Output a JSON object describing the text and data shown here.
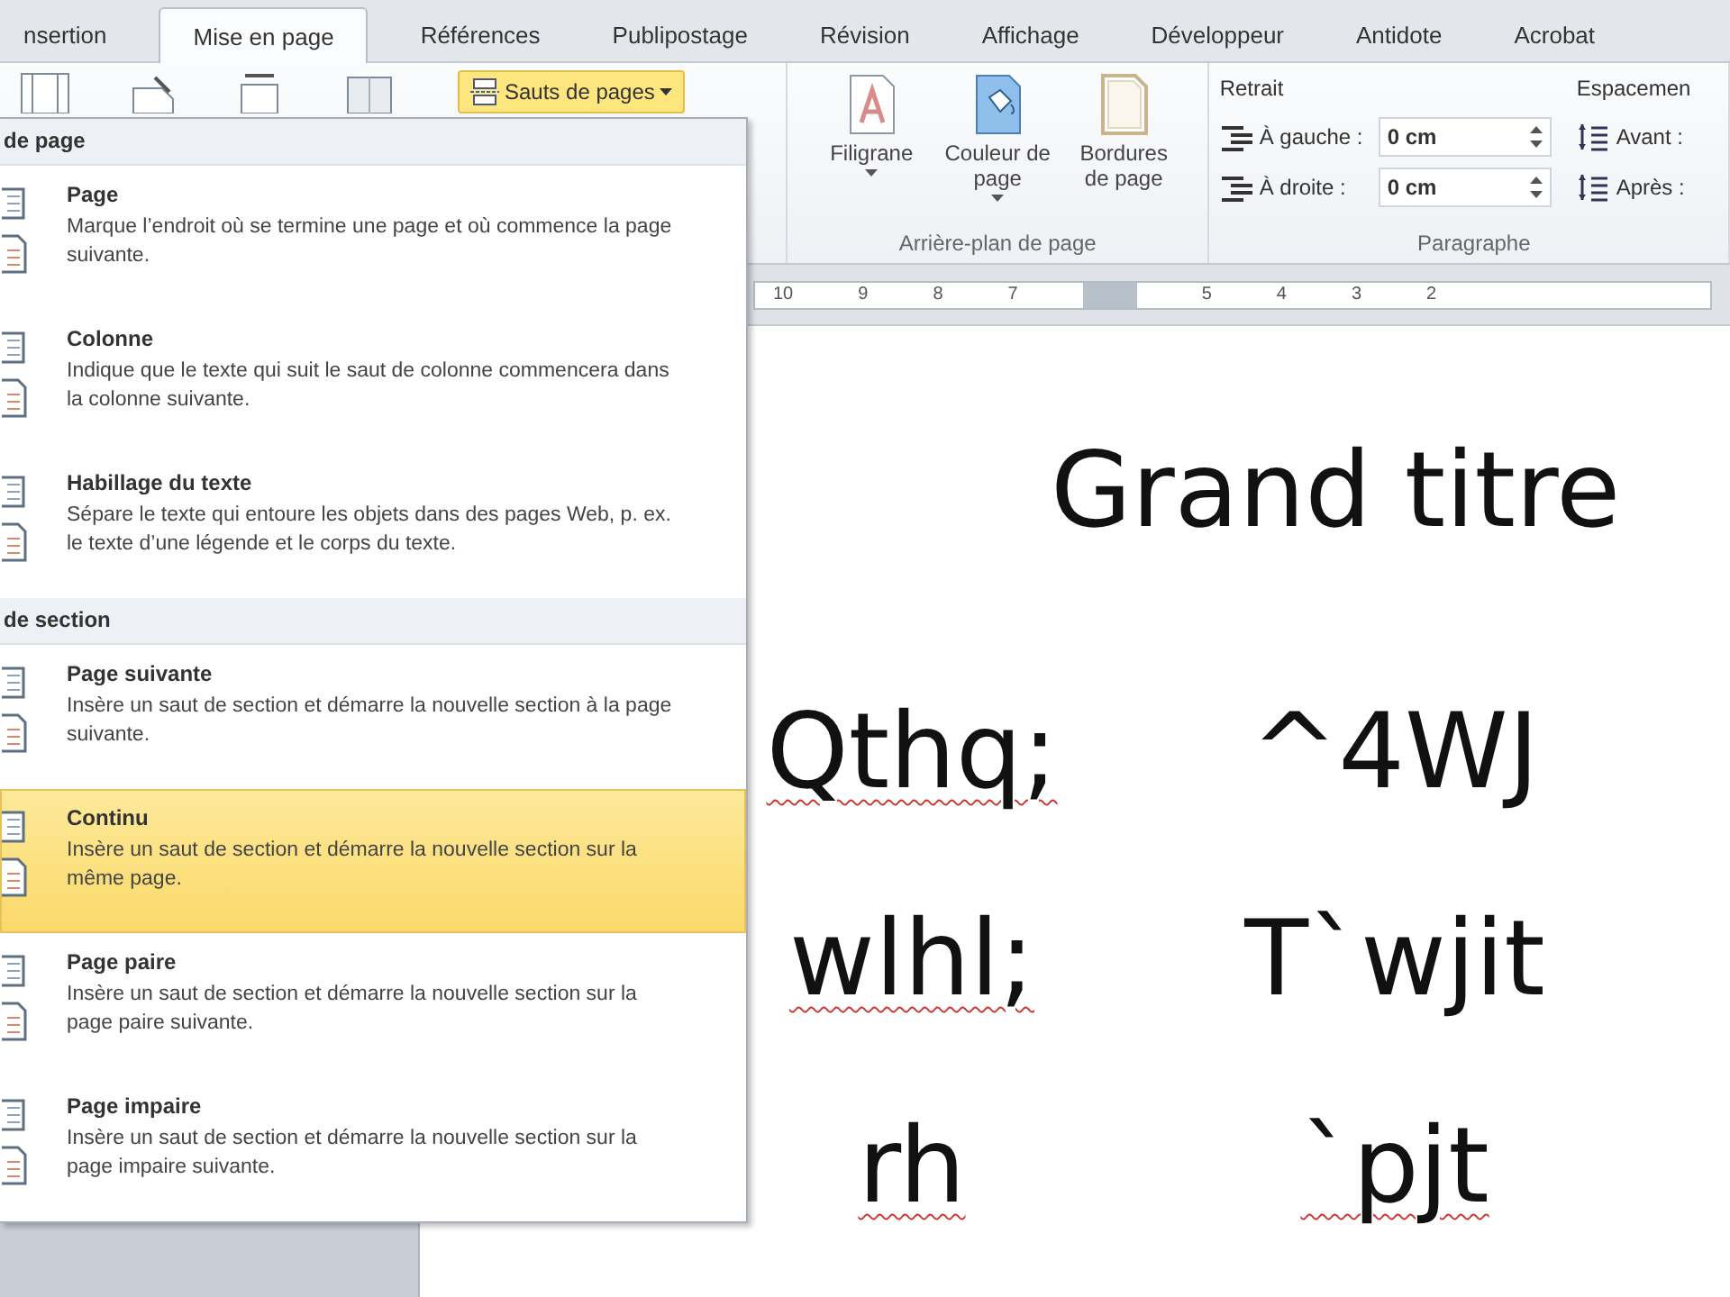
{
  "tabs": [
    {
      "label": "nsertion",
      "selected": false
    },
    {
      "label": "Mise en page",
      "selected": true
    },
    {
      "label": "Références",
      "selected": false
    },
    {
      "label": "Publipostage",
      "selected": false
    },
    {
      "label": "Révision",
      "selected": false
    },
    {
      "label": "Affichage",
      "selected": false
    },
    {
      "label": "Développeur",
      "selected": false
    },
    {
      "label": "Antidote",
      "selected": false
    },
    {
      "label": "Acrobat",
      "selected": false
    }
  ],
  "ribbon": {
    "page_setup": {
      "breaks_button": {
        "label": "Sauts de pages",
        "pressed": true
      }
    },
    "page_background": {
      "buttons": [
        {
          "label": "Filigrane",
          "kind": "watermark",
          "dropdown": true
        },
        {
          "label": "Couleur de page",
          "kind": "color",
          "dropdown": true
        },
        {
          "label": "Bordures de page",
          "kind": "borders",
          "dropdown": false
        }
      ],
      "group_label": "Arrière-plan de page"
    },
    "paragraph": {
      "indent": {
        "title": "Retrait",
        "fields": [
          {
            "label": "À gauche :",
            "value": "0 cm"
          },
          {
            "label": "À droite :",
            "value": "0 cm"
          }
        ]
      },
      "spacing": {
        "title": "Espacemen",
        "fields": [
          {
            "label": "Avant :"
          },
          {
            "label": "Après :"
          }
        ]
      },
      "group_label": "Paragraphe"
    }
  },
  "ruler": {
    "labels": [
      "10",
      "9",
      "8",
      "7",
      "5",
      "4",
      "3",
      "2"
    ]
  },
  "menu": {
    "sections": [
      {
        "header": "de page",
        "items": [
          {
            "title": "Page",
            "description": "Marque l’endroit où se termine une page et où commence la page suivante.",
            "selected": false
          },
          {
            "title": "Colonne",
            "description": "Indique que le texte qui suit le saut de colonne commencera dans la colonne suivante.",
            "selected": false
          },
          {
            "title": "Habillage du texte",
            "description": "Sépare le texte qui entoure les objets dans des pages Web, p. ex. le texte d’une légende et le corps du texte.",
            "selected": false
          }
        ]
      },
      {
        "header": "de section",
        "items": [
          {
            "title": "Page suivante",
            "description": "Insère un saut de section et démarre la nouvelle section à la page suivante.",
            "selected": false
          },
          {
            "title": "Continu",
            "description": "Insère un saut de section et démarre la nouvelle section sur la même page.",
            "selected": true
          },
          {
            "title": "Page paire",
            "description": "Insère un saut de section et démarre la nouvelle section sur la page paire suivante.",
            "selected": false
          },
          {
            "title": "Page impaire",
            "description": "Insère un saut de section et démarre la nouvelle section sur la page impaire suivante.",
            "selected": false
          }
        ]
      }
    ]
  },
  "document": {
    "title": "Grand titre",
    "rows": [
      [
        {
          "text": "Qthq;",
          "misspelled": true
        },
        {
          "text": "^4WJ",
          "misspelled": false
        }
      ],
      [
        {
          "text": "wlhl;",
          "misspelled": true
        },
        {
          "text": "T`wjit",
          "misspelled": false
        }
      ],
      [
        {
          "text": "rh",
          "misspelled": true
        },
        {
          "text": "`pjt",
          "misspelled": true
        }
      ]
    ]
  }
}
